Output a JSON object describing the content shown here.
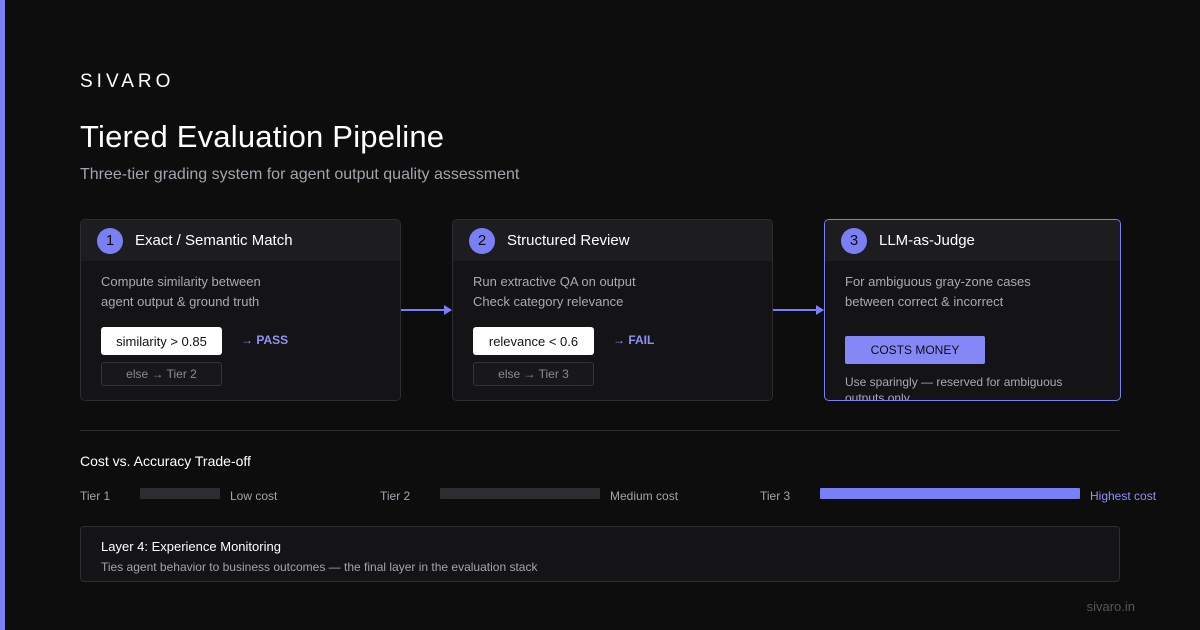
{
  "brand": "SIVARO",
  "title": "Tiered Evaluation Pipeline",
  "subtitle": "Three-tier grading system for agent output quality assessment",
  "tiers": [
    {
      "number": "1",
      "title": "Exact / Semantic Match",
      "description": "Compute similarity between\nagent output & ground truth",
      "condition": "similarity > 0.85",
      "outcome": "→ PASS",
      "else": "else → Tier 2"
    },
    {
      "number": "2",
      "title": "Structured Review",
      "description": "Run extractive QA on output\nCheck category relevance",
      "condition": "relevance < 0.6",
      "outcome": "→ FAIL",
      "else": "else → Tier 3"
    },
    {
      "number": "3",
      "title": "LLM-as-Judge",
      "description": "For ambiguous gray-zone cases\nbetween correct & incorrect",
      "badge": "COSTS MONEY",
      "note": "Use sparingly — reserved for ambiguous outputs only"
    }
  ],
  "tradeoff": {
    "title": "Cost vs. Accuracy Trade-off",
    "rows": [
      {
        "tier": "Tier 1",
        "cost": "Low cost"
      },
      {
        "tier": "Tier 2",
        "cost": "Medium cost"
      },
      {
        "tier": "Tier 3",
        "cost": "Highest cost"
      }
    ],
    "colors": {
      "low": "#2c2c31",
      "medium": "#2c2c31",
      "high": "#7b7ff5"
    }
  },
  "layer4": {
    "title": "Layer 4: Experience Monitoring",
    "description": "Ties agent behavior to business outcomes — the final layer in the evaluation stack"
  },
  "footer": "sivaro.in",
  "colors": {
    "accent": "#7b7ff5",
    "background": "#0d0d0e",
    "card": "#141416"
  }
}
